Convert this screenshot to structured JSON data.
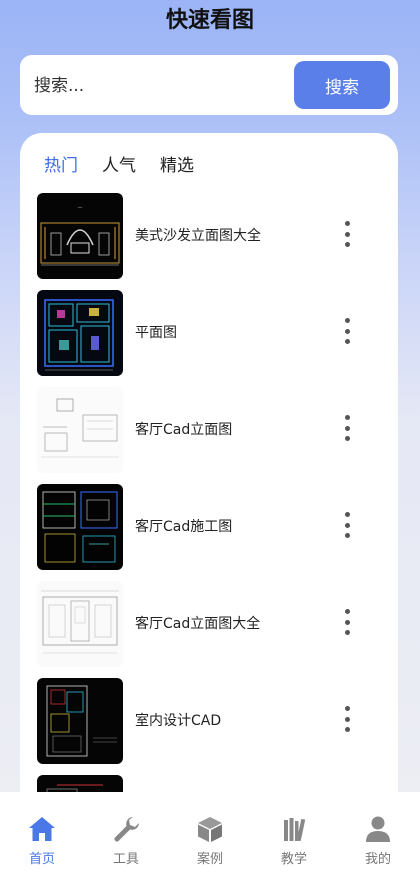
{
  "header": {
    "title": "快速看图"
  },
  "search": {
    "placeholder": "搜索...",
    "button_label": "搜索"
  },
  "tabs": [
    {
      "label": "热门",
      "active": true
    },
    {
      "label": "人气",
      "active": false
    },
    {
      "label": "精选",
      "active": false
    }
  ],
  "list": [
    {
      "label": "美式沙发立面图大全"
    },
    {
      "label": "平面图"
    },
    {
      "label": "客厅Cad立面图"
    },
    {
      "label": "客厅Cad施工图"
    },
    {
      "label": "客厅Cad立面图大全"
    },
    {
      "label": "室内设计CAD"
    },
    {
      "label": ""
    }
  ],
  "bottom_nav": [
    {
      "label": "首页",
      "icon": "home-icon",
      "active": true
    },
    {
      "label": "工具",
      "icon": "wrench-icon",
      "active": false
    },
    {
      "label": "案例",
      "icon": "cube-icon",
      "active": false
    },
    {
      "label": "教学",
      "icon": "books-icon",
      "active": false
    },
    {
      "label": "我的",
      "icon": "person-icon",
      "active": false
    }
  ],
  "colors": {
    "accent": "#5b7fe8",
    "tab_active": "#3e6de6",
    "nav_active": "#4a78e6",
    "nav_inactive": "#999999"
  }
}
